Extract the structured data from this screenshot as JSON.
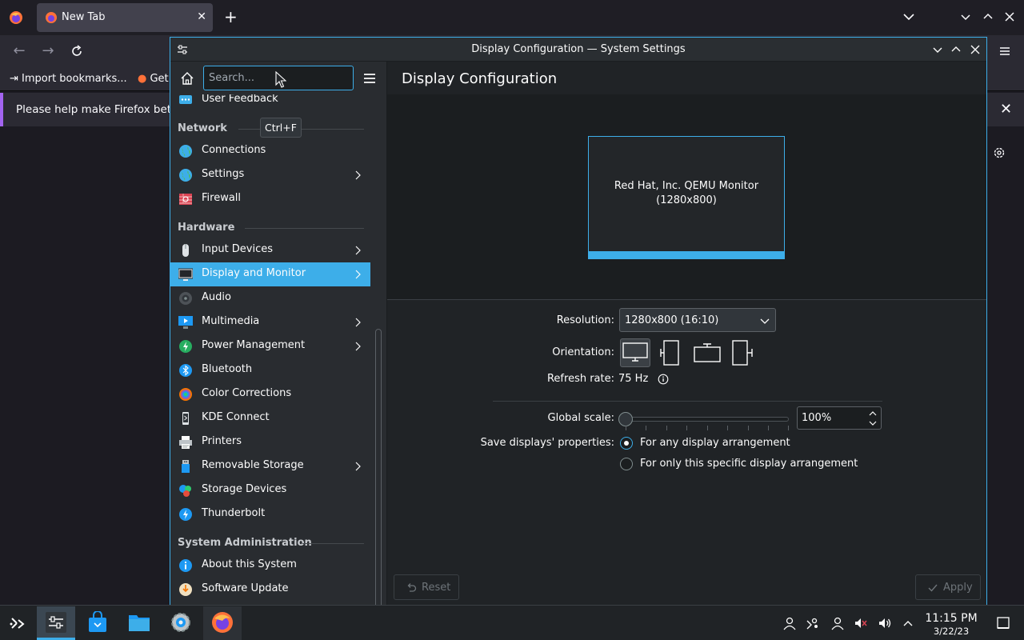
{
  "firefox": {
    "tab_title": "New Tab",
    "new_tab": "+",
    "bookmarks": {
      "import": "Import bookmarks...",
      "get_started": "Get"
    },
    "notification": "Please help make Firefox bette"
  },
  "settings": {
    "window_title": "Display Configuration — System Settings",
    "search_placeholder": "Search...",
    "search_tooltip": "Ctrl+F",
    "page_title": "Display Configuration",
    "sidebar": {
      "top_item": "User Feedback",
      "categories": [
        {
          "title": "Network",
          "items": [
            {
              "label": "Connections",
              "icon": "globe-icon",
              "submenu": false
            },
            {
              "label": "Settings",
              "icon": "globe-icon",
              "submenu": true
            },
            {
              "label": "Firewall",
              "icon": "firewall-icon",
              "submenu": false
            }
          ]
        },
        {
          "title": "Hardware",
          "items": [
            {
              "label": "Input Devices",
              "icon": "mouse-icon",
              "submenu": true
            },
            {
              "label": "Display and Monitor",
              "icon": "monitor-icon",
              "submenu": true,
              "selected": true
            },
            {
              "label": "Audio",
              "icon": "speaker-icon",
              "submenu": false
            },
            {
              "label": "Multimedia",
              "icon": "multimedia-icon",
              "submenu": true
            },
            {
              "label": "Power Management",
              "icon": "power-icon",
              "submenu": true
            },
            {
              "label": "Bluetooth",
              "icon": "bluetooth-icon",
              "submenu": false
            },
            {
              "label": "Color Corrections",
              "icon": "color-icon",
              "submenu": false
            },
            {
              "label": "KDE Connect",
              "icon": "phone-icon",
              "submenu": false
            },
            {
              "label": "Printers",
              "icon": "printer-icon",
              "submenu": false
            },
            {
              "label": "Removable Storage",
              "icon": "usb-icon",
              "submenu": true
            },
            {
              "label": "Storage Devices",
              "icon": "storage-icon",
              "submenu": false
            },
            {
              "label": "Thunderbolt",
              "icon": "thunderbolt-icon",
              "submenu": false
            }
          ]
        },
        {
          "title": "System Administration",
          "items": [
            {
              "label": "About this System",
              "icon": "info-icon",
              "submenu": false
            },
            {
              "label": "Software Update",
              "icon": "update-icon",
              "submenu": false
            }
          ]
        }
      ]
    },
    "monitor": {
      "name": "Red Hat, Inc. QEMU Monitor",
      "resolution": "(1280x800)"
    },
    "form": {
      "resolution_label": "Resolution:",
      "resolution_value": "1280x800 (16:10)",
      "orientation_label": "Orientation:",
      "orientation_options": [
        "landscape",
        "portrait-left",
        "landscape-flipped",
        "portrait-right"
      ],
      "orientation_selected": "landscape",
      "refresh_label": "Refresh rate:",
      "refresh_value": "75 Hz",
      "scale_label": "Global scale:",
      "scale_value": "100%",
      "save_label": "Save displays' properties:",
      "save_options": [
        "For any display arrangement",
        "For only this specific display arrangement"
      ],
      "save_selected": 0
    },
    "buttons": {
      "reset": "Reset",
      "apply": "Apply"
    }
  },
  "taskbar": {
    "time": "11:15 PM",
    "date": "3/22/23"
  },
  "colors": {
    "accent": "#3daee9",
    "window_bg": "#202326",
    "sidebar_bg": "#292c30"
  }
}
